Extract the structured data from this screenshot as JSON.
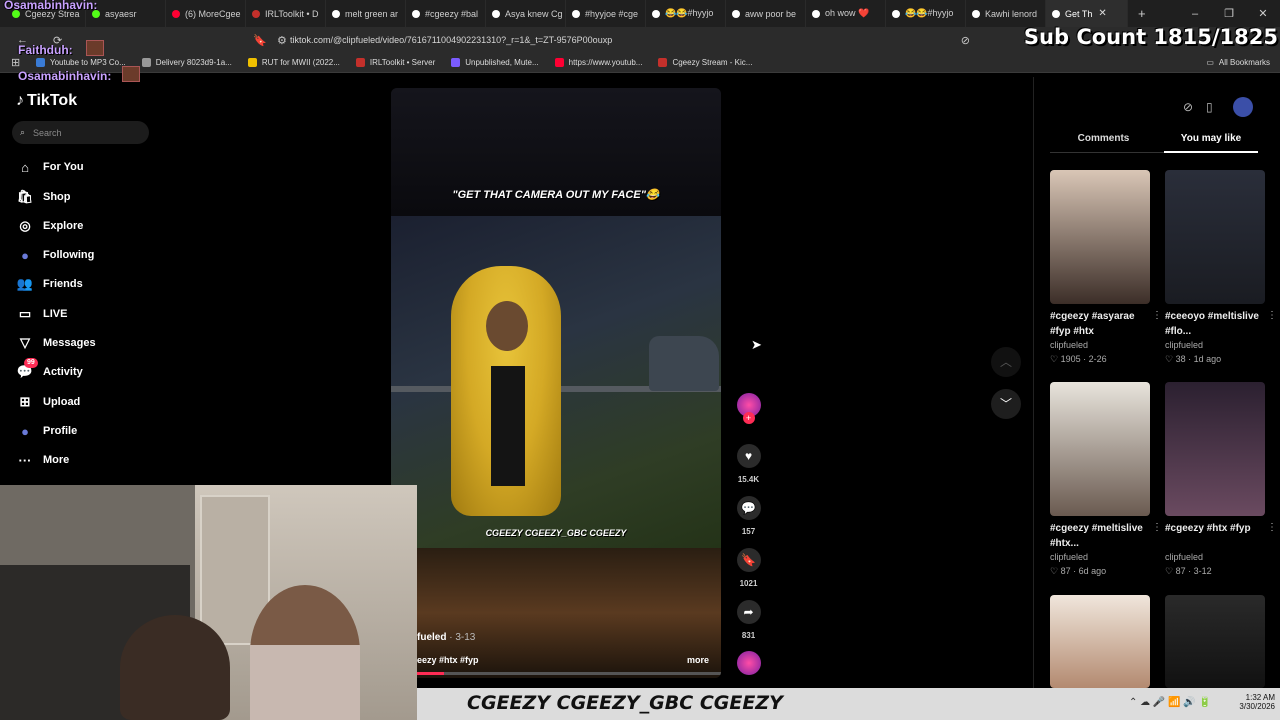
{
  "browser": {
    "tabs": [
      {
        "label": "Cgeezy Strea",
        "color": "#53fc18"
      },
      {
        "label": "asyaesr",
        "color": "#53fc18"
      },
      {
        "label": "(6) MoreCgee",
        "color": "#ff0033"
      },
      {
        "label": "IRLToolkit • D",
        "color": "#c4302b"
      },
      {
        "label": "melt green ar",
        "color": "#ffffff"
      },
      {
        "label": "#cgeezy #bal",
        "color": "#ffffff"
      },
      {
        "label": "Asya knew Cg",
        "color": "#ffffff"
      },
      {
        "label": "#hyyjoe #cge",
        "color": "#ffffff"
      },
      {
        "label": "😂😂#hyyjo",
        "color": "#ffffff"
      },
      {
        "label": "aww poor be",
        "color": "#ffffff"
      },
      {
        "label": "oh wow ❤️",
        "color": "#ffffff"
      },
      {
        "label": "😂😂#hyyjo",
        "color": "#ffffff"
      },
      {
        "label": "Kawhi lenord",
        "color": "#ffffff"
      },
      {
        "label": "Get Th",
        "color": "#ffffff",
        "active": true
      }
    ],
    "new_tab": "+",
    "url": "tiktok.com/@clipfueled/video/7616711004902231310?_r=1&_t=ZT-9576P00ouxp",
    "bookmarks": [
      {
        "label": "Youtube to MP3 Co...",
        "color": "#3a7bd5"
      },
      {
        "label": "Delivery 8023d9-1a...",
        "color": "#999999"
      },
      {
        "label": "RUT for MWII (2022...",
        "color": "#f0c000"
      },
      {
        "label": "IRLToolkit • Server",
        "color": "#c4302b"
      },
      {
        "label": "Unpublished, Mute...",
        "color": "#7b5cff"
      },
      {
        "label": "https://www.youtub...",
        "color": "#ff0033"
      },
      {
        "label": "Cgeezy Stream - Kic...",
        "color": "#c4302b"
      }
    ],
    "all_bookmarks": "All Bookmarks"
  },
  "overlay": {
    "chat": [
      {
        "name": "Osamabinhavin:"
      },
      {
        "name": "Faithduh:"
      },
      {
        "name": "Osamabinhavin:"
      }
    ],
    "sub_count": "Sub Count 1815/1825"
  },
  "tiktok": {
    "logo": "TikTok",
    "search_placeholder": "Search",
    "nav": [
      {
        "label": "For You",
        "icon": "home-icon"
      },
      {
        "label": "Shop",
        "icon": "shopping-bag-icon"
      },
      {
        "label": "Explore",
        "icon": "compass-icon"
      },
      {
        "label": "Following",
        "icon": "avatar-icon"
      },
      {
        "label": "Friends",
        "icon": "friends-icon"
      },
      {
        "label": "LIVE",
        "icon": "live-icon"
      },
      {
        "label": "Messages",
        "icon": "messages-icon"
      },
      {
        "label": "Activity",
        "icon": "activity-icon",
        "badge": "99"
      },
      {
        "label": "Upload",
        "icon": "plus-square-icon"
      },
      {
        "label": "Profile",
        "icon": "profile-icon"
      },
      {
        "label": "More",
        "icon": "more-icon"
      }
    ],
    "video": {
      "caption_top": "\"GET THAT CAMERA OUT MY FACE\"😂",
      "socials_line": "CGEEZY  CGEEZY_GBC  CGEEZY",
      "author": "fueled",
      "date": "3-13",
      "hashtags": "eezy #htx #fyp",
      "more": "more",
      "progress": 0.09
    },
    "actions": {
      "likes": "15.4K",
      "comments": "157",
      "saves": "1021",
      "shares": "831"
    },
    "panel_tabs": {
      "comments": "Comments",
      "you_may_like": "You may like"
    },
    "recommendations": [
      {
        "title": "#cgeezy #asyarae #fyp #htx",
        "user": "clipfueled",
        "likes": "1905",
        "date": "2-26"
      },
      {
        "title": "#ceeoyo #meltislive #flo...",
        "user": "clipfueled",
        "likes": "38",
        "date": "1d ago"
      },
      {
        "title": "#cgeezy #meltislive #htx...",
        "user": "clipfueled",
        "likes": "87",
        "date": "6d ago"
      },
      {
        "title": "#cgeezy #htx #fyp",
        "user": "clipfueled",
        "likes": "87",
        "date": "3-12"
      },
      {
        "title": "",
        "user": "",
        "likes": "",
        "date": ""
      },
      {
        "title": "",
        "user": "",
        "likes": "",
        "date": ""
      }
    ]
  },
  "stream_banner": "CGEEZY  CGEEZY_GBC  CGEEZY",
  "taskbar": {
    "time": "1:32 AM",
    "date": "3/30/2026"
  }
}
